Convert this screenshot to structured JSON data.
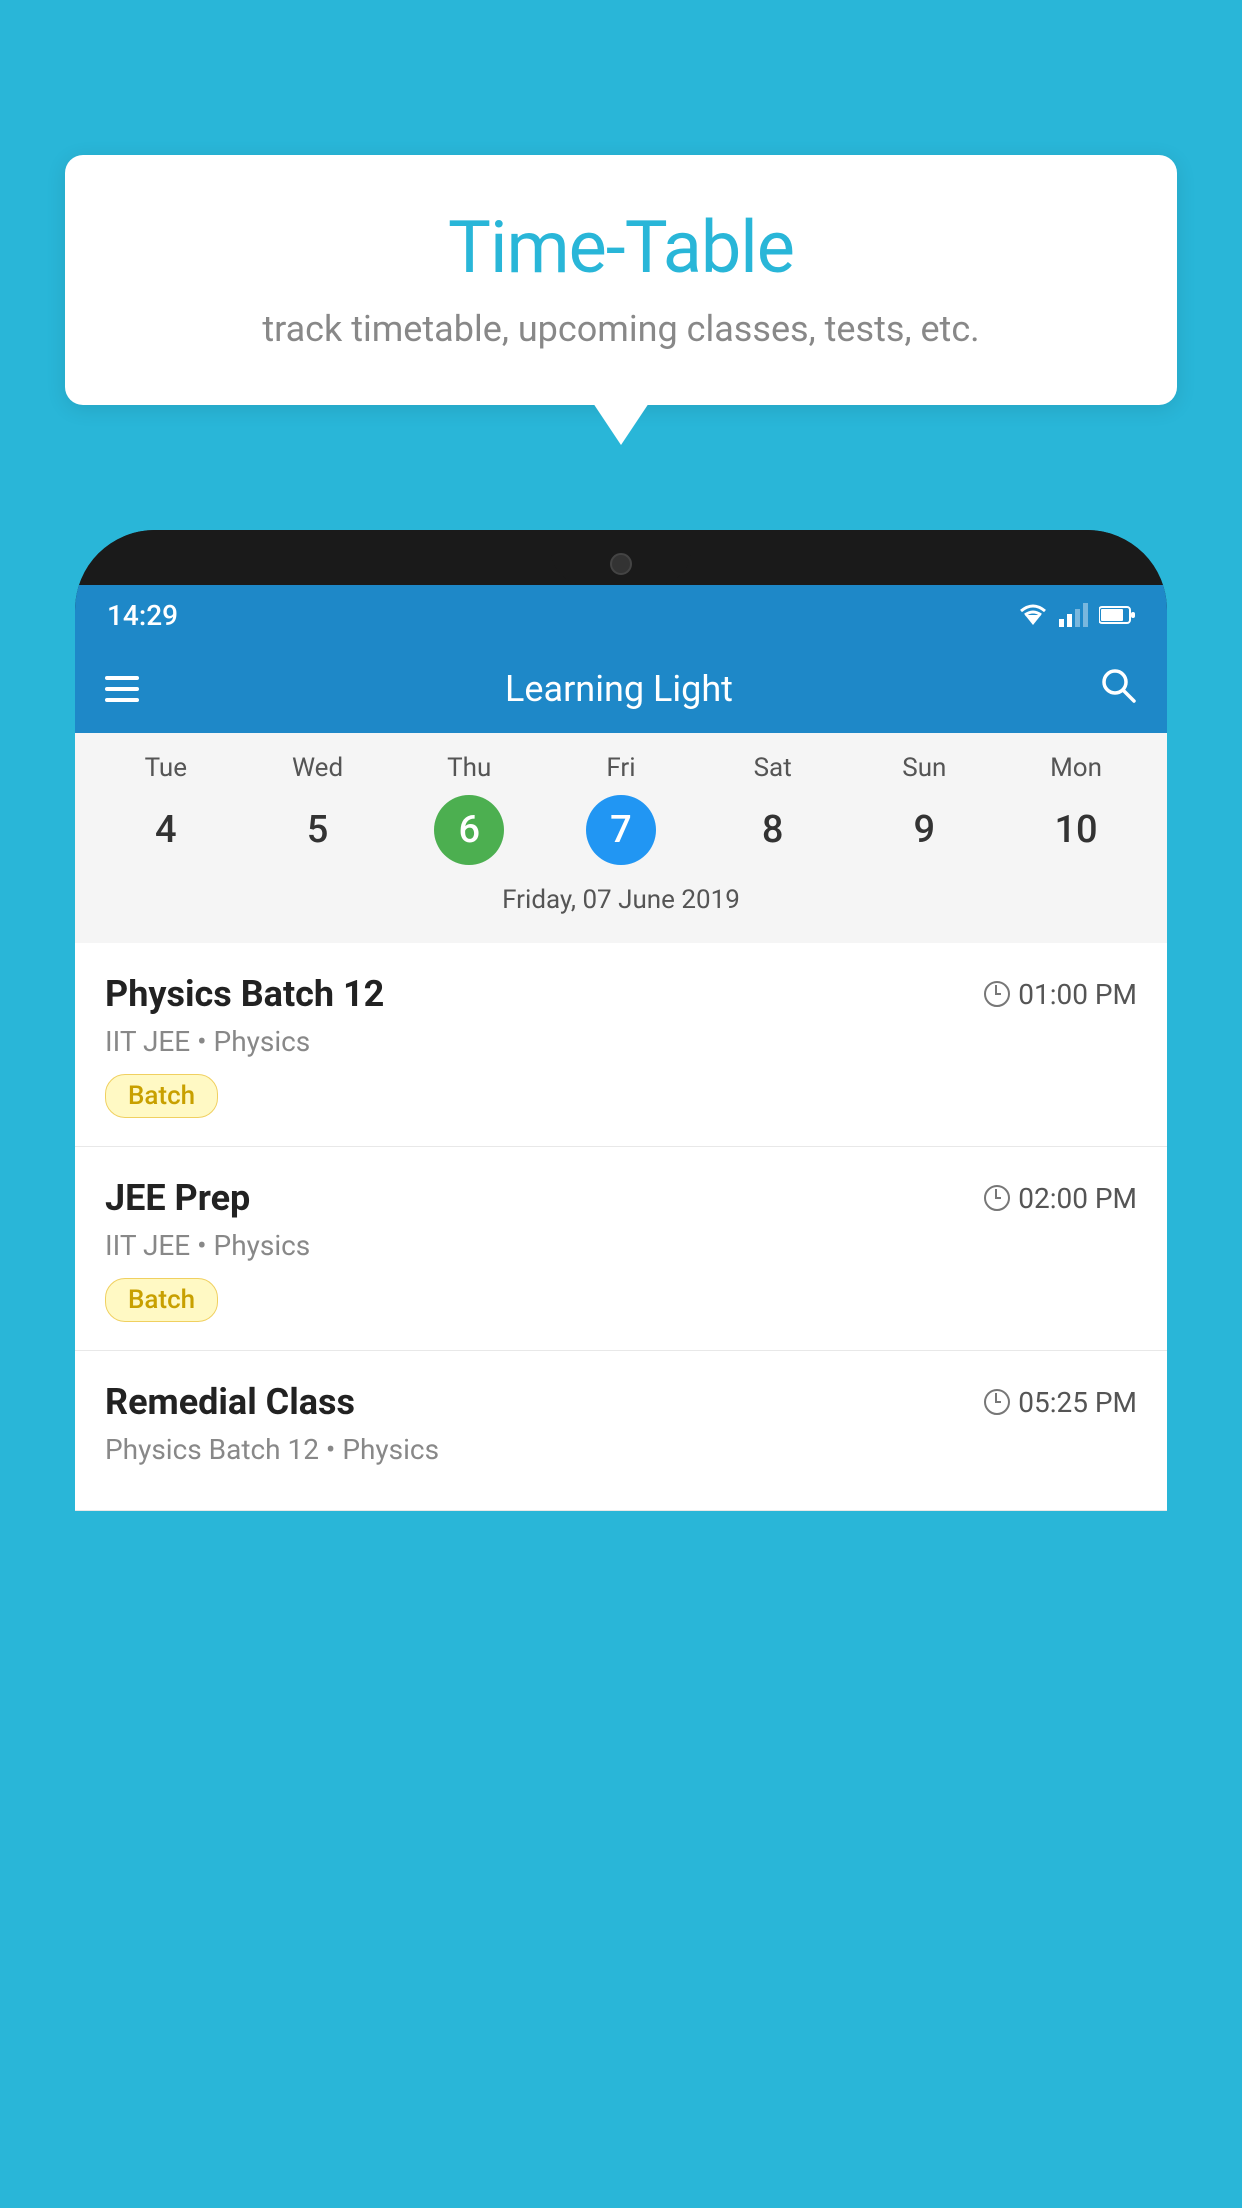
{
  "background_color": "#29B6D8",
  "bubble": {
    "title": "Time-Table",
    "subtitle": "track timetable, upcoming classes, tests, etc."
  },
  "phone": {
    "status_bar": {
      "time": "14:29"
    },
    "app_bar": {
      "title": "Learning Light"
    },
    "calendar": {
      "days": [
        {
          "label": "Tue",
          "number": "4"
        },
        {
          "label": "Wed",
          "number": "5"
        },
        {
          "label": "Thu",
          "number": "6",
          "style": "today"
        },
        {
          "label": "Fri",
          "number": "7",
          "style": "selected"
        },
        {
          "label": "Sat",
          "number": "8"
        },
        {
          "label": "Sun",
          "number": "9"
        },
        {
          "label": "Mon",
          "number": "10"
        }
      ],
      "selected_date_label": "Friday, 07 June 2019"
    },
    "classes": [
      {
        "name": "Physics Batch 12",
        "time": "01:00 PM",
        "subtitle": "IIT JEE • Physics",
        "tag": "Batch"
      },
      {
        "name": "JEE Prep",
        "time": "02:00 PM",
        "subtitle": "IIT JEE • Physics",
        "tag": "Batch"
      },
      {
        "name": "Remedial Class",
        "time": "05:25 PM",
        "subtitle": "Physics Batch 12 • Physics",
        "tag": ""
      }
    ]
  }
}
